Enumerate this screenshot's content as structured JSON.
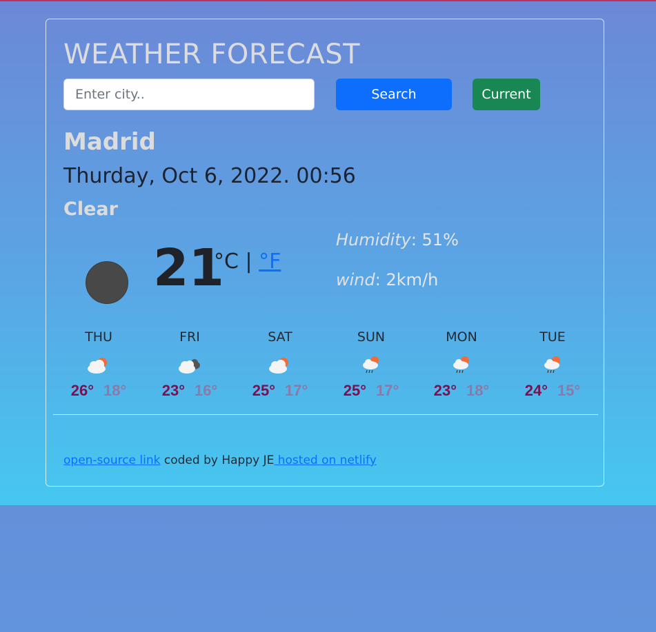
{
  "app": {
    "title": "WEATHER FORECAST"
  },
  "search": {
    "placeholder": "Enter city..",
    "value": "",
    "button_label": "Search",
    "current_label": "Current"
  },
  "weather": {
    "city": "Madrid",
    "datetime": "Thurday, Oct 6, 2022. 00:56",
    "description": "Clear",
    "temperature": "21",
    "unit_c": "°C",
    "unit_sep": " | ",
    "unit_f": "°F",
    "humidity_label": "Humidity",
    "humidity_value": ": 51%",
    "wind_label": "wind",
    "wind_value": ": 2km/h",
    "icon": "night-clear-icon"
  },
  "forecast": [
    {
      "day": "THU",
      "max": "26°",
      "min": "18°",
      "icon": "partly-cloudy-day-icon"
    },
    {
      "day": "FRI",
      "max": "23°",
      "min": "16°",
      "icon": "broken-clouds-icon"
    },
    {
      "day": "SAT",
      "max": "25°",
      "min": "17°",
      "icon": "partly-cloudy-day-icon"
    },
    {
      "day": "SUN",
      "max": "25°",
      "min": "17°",
      "icon": "rain-sun-icon"
    },
    {
      "day": "MON",
      "max": "23°",
      "min": "18°",
      "icon": "rain-sun-icon"
    },
    {
      "day": "TUE",
      "max": "24°",
      "min": "15°",
      "icon": "rain-sun-icon"
    }
  ],
  "footer": {
    "link1": "open-source link",
    "text": " coded by Happy JE",
    "link2": " hosted on netlify"
  },
  "colors": {
    "search_button": "#0d6efd",
    "current_button": "#198754",
    "max_temp": "#7a1050",
    "min_temp": "#8a7aa8"
  }
}
